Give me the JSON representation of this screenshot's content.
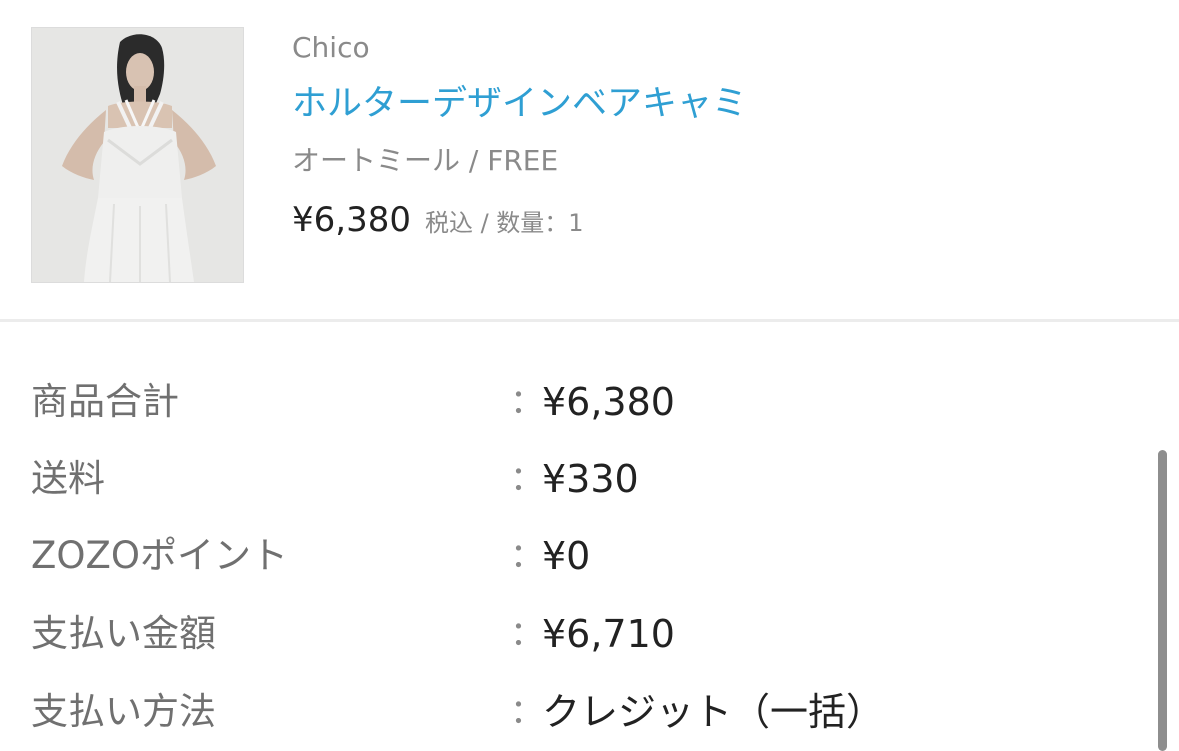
{
  "product": {
    "image_alt": "product-photo",
    "brand": "Chico",
    "title": "ホルターデザインベアキャミ",
    "variant": "オートミール / FREE",
    "price": "¥6,380",
    "price_meta": "税込 / 数量：1"
  },
  "summary": {
    "rows": [
      {
        "label": "商品合計",
        "colon": "：",
        "value": "¥6,380"
      },
      {
        "label": "送料",
        "colon": "：",
        "value": "¥330"
      },
      {
        "label": "ZOZOポイント",
        "colon": "：",
        "value": "¥0"
      },
      {
        "label": "支払い金額",
        "colon": "：",
        "value": "¥6,710"
      },
      {
        "label": "支払い方法",
        "colon": "：",
        "value": "クレジット（一括）"
      }
    ]
  },
  "colors": {
    "accent_link": "#2f9fd3",
    "muted_text": "#8a8a8a",
    "primary_text": "#222222"
  }
}
